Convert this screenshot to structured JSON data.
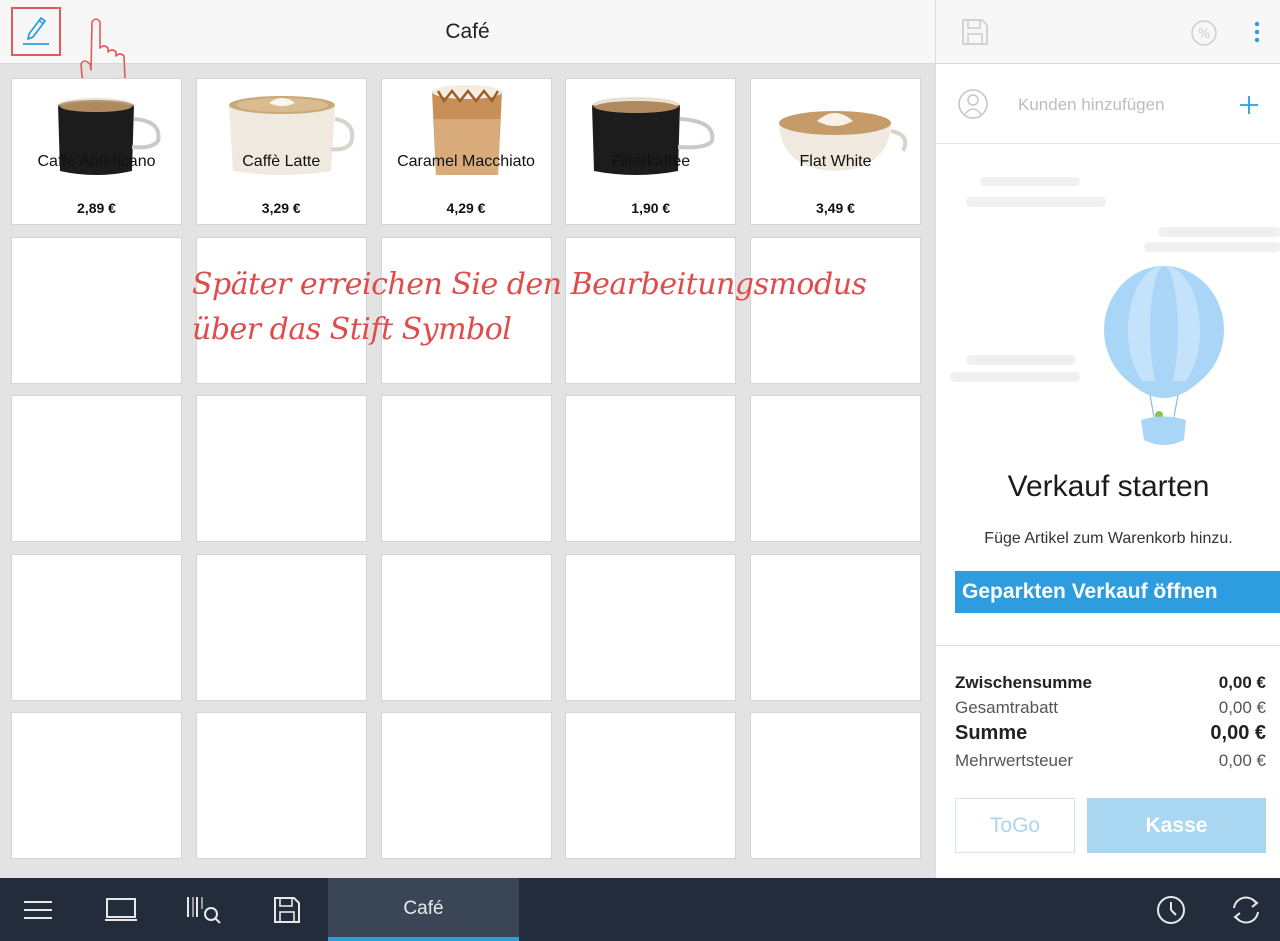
{
  "header": {
    "category_title": "Café"
  },
  "products": [
    {
      "name": "Caffè Americano",
      "price": "2,89 €",
      "image": "americano-cup"
    },
    {
      "name": "Caffè Latte",
      "price": "3,29 €",
      "image": "latte-cup"
    },
    {
      "name": "Caramel Macchiato",
      "price": "4,29 €",
      "image": "macchiato-glass"
    },
    {
      "name": "Filterkaffee",
      "price": "1,90 €",
      "image": "filter-coffee-cup"
    },
    {
      "name": "Flat White",
      "price": "3,49 €",
      "image": "flat-white-cup"
    }
  ],
  "annotation": {
    "line1": "Später erreichen Sie den Bearbeitungsmodus",
    "line2": "über das Stift Symbol",
    "color": "#e04b4b"
  },
  "customer": {
    "placeholder": "Kunden hinzufügen"
  },
  "empty_state": {
    "title": "Verkauf starten",
    "subtitle": "Füge Artikel zum Warenkorb hinzu.",
    "parked_button": "Geparkten Verkauf öffnen"
  },
  "totals": {
    "subtotal_label": "Zwischensumme",
    "subtotal_value": "0,00 €",
    "discount_label": "Gesamtrabatt",
    "discount_value": "0,00 €",
    "sum_label": "Summe",
    "sum_value": "0,00 €",
    "tax_label": "Mehrwertsteuer",
    "tax_value": "0,00 €"
  },
  "actions": {
    "togo_label": "ToGo",
    "checkout_label": "Kasse"
  },
  "bottom_bar": {
    "active_tab": "Café"
  },
  "colors": {
    "accent": "#2d9de0",
    "bottom_bar": "#222c3b",
    "annotation": "#e04b4b"
  }
}
